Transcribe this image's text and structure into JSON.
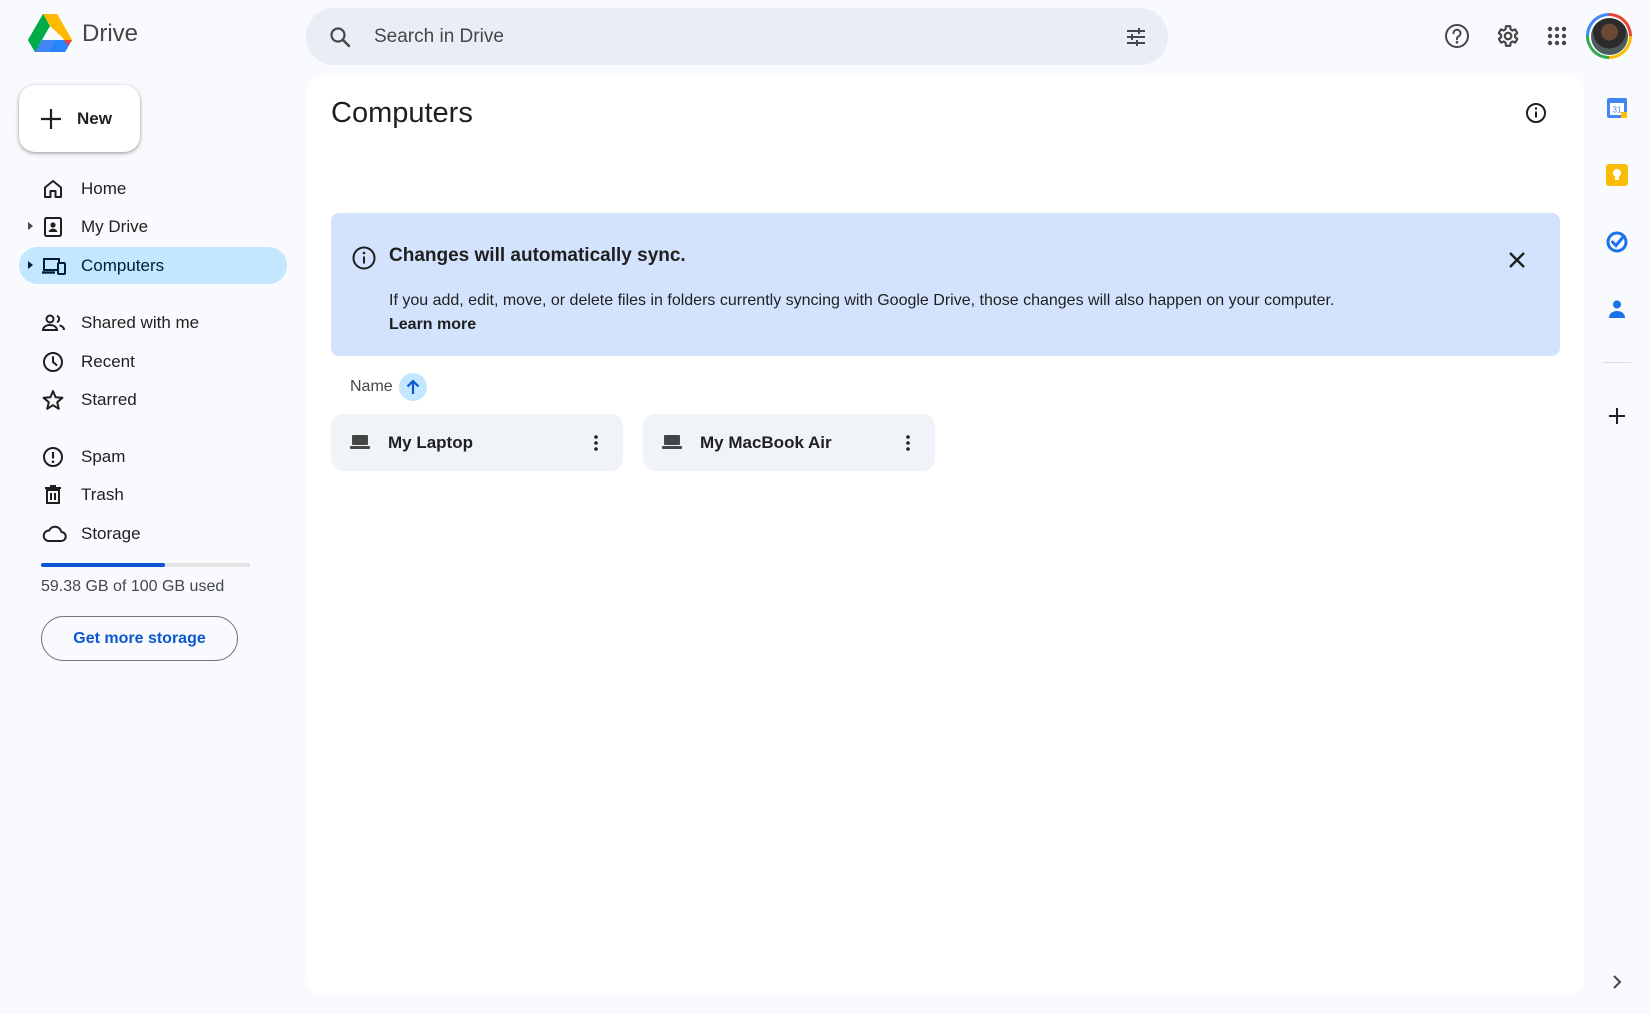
{
  "app": {
    "name": "Drive",
    "brand_colors": {
      "blue": "#4285f4",
      "green": "#34a853",
      "yellow": "#fbbc04",
      "red": "#ea4335",
      "accent": "#0b57d0",
      "active_bg": "#c2e7ff",
      "banner_bg": "#d3e3fd"
    }
  },
  "search": {
    "placeholder": "Search in Drive",
    "icon": "search-icon",
    "filter_icon": "tune-icon"
  },
  "header": {
    "icons": [
      "help-icon",
      "settings-icon",
      "apps-grid-icon",
      "account-avatar"
    ]
  },
  "sidebar": {
    "new_label": "New",
    "items": [
      {
        "label": "Home",
        "icon": "home-icon",
        "active": false,
        "expandable": false
      },
      {
        "label": "My Drive",
        "icon": "my-drive-icon",
        "active": false,
        "expandable": true
      },
      {
        "label": "Computers",
        "icon": "computers-icon",
        "active": true,
        "expandable": true
      },
      {
        "label": "Shared with me",
        "icon": "shared-icon",
        "active": false,
        "expandable": false
      },
      {
        "label": "Recent",
        "icon": "clock-icon",
        "active": false,
        "expandable": false
      },
      {
        "label": "Starred",
        "icon": "star-icon",
        "active": false,
        "expandable": false
      },
      {
        "label": "Spam",
        "icon": "spam-icon",
        "active": false,
        "expandable": false
      },
      {
        "label": "Trash",
        "icon": "trash-icon",
        "active": false,
        "expandable": false
      },
      {
        "label": "Storage",
        "icon": "cloud-icon",
        "active": false,
        "expandable": false
      }
    ],
    "storage": {
      "used_text": "59.38 GB of 100 GB used",
      "used_fraction": 0.5938,
      "button_label": "Get more storage"
    }
  },
  "main": {
    "title": "Computers",
    "banner": {
      "title": "Changes will automatically sync.",
      "body": "If you add, edit, move, or delete files in folders currently syncing with Google Drive, those changes will also happen on your computer.",
      "link": "Learn more"
    },
    "sort": {
      "label": "Name",
      "direction": "ascending"
    },
    "computers": [
      {
        "name": "My Laptop",
        "icon": "laptop-icon"
      },
      {
        "name": "My MacBook Air",
        "icon": "laptop-icon"
      }
    ]
  },
  "right_rail": {
    "apps": [
      "calendar-icon",
      "keep-icon",
      "tasks-icon",
      "contacts-icon",
      "add-icon",
      "chevron-right-icon"
    ]
  }
}
